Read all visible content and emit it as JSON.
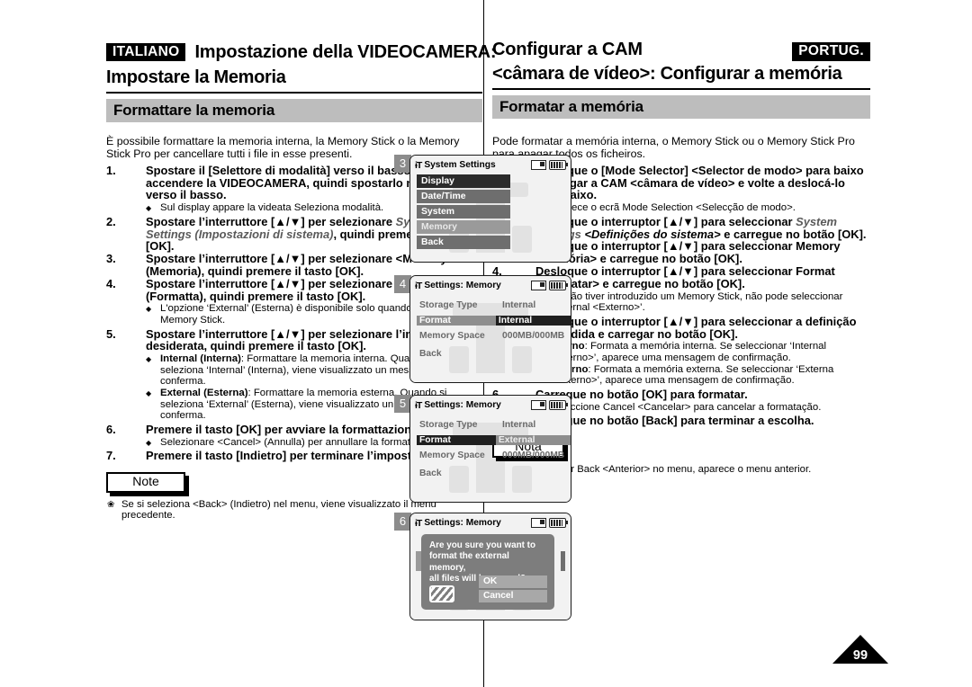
{
  "header": {
    "left": {
      "lang_tag": "ITALIANO",
      "title_line1": "Impostazione della VIDEOCAMERA:",
      "title_line2": "Impostare la Memoria",
      "section": "Formattare la memoria"
    },
    "right": {
      "lang_tag": "PORTUG.",
      "title_line1": "Configurar a CAM",
      "title_line2": "<câmara de vídeo>: Configurar a memória",
      "section": "Formatar a memória"
    }
  },
  "italian": {
    "intro": "È possibile formattare la memoria interna, la Memory Stick o la Memory Stick Pro per cancellare tutti i file in esse presenti.",
    "steps": [
      {
        "num": "1.",
        "text_parts": [
          {
            "t": "Spostare il [Selettore di modalità]  verso il basso per accendere la VIDEOCAMERA, quindi  spostarlo nuovamente verso il basso.",
            "style": "bold"
          }
        ],
        "bullets": [
          "Sul display appare la videata Seleziona modalità."
        ]
      },
      {
        "num": "2.",
        "text_parts": [
          {
            "t": "Spostare l’interruttore [▲/▼] per selezionare ",
            "style": "bold"
          },
          {
            "t": "System Settings (Impostazioni di sistema)",
            "style": "italic-gray"
          },
          {
            "t": ", quindi premere il tasto [OK].",
            "style": "bold"
          }
        ],
        "bullets": []
      },
      {
        "num": "3.",
        "text_parts": [
          {
            "t": "Spostare l’interruttore [▲/▼] per selezionare <Memory> (Memoria), quindi premere il tasto [OK].",
            "style": "bold"
          }
        ],
        "bullets": []
      },
      {
        "num": "4.",
        "text_parts": [
          {
            "t": "Spostare l’interruttore [▲/▼] per selezionare <Format> (Formatta), quindi premere il tasto [OK].",
            "style": "bold"
          }
        ],
        "bullets": [
          "L'opzione ‘External’ (Esterna) è disponibile solo quando si inserisce la Memory Stick."
        ]
      },
      {
        "num": "5.",
        "text_parts": [
          {
            "t": "Spostare l’interruttore [▲/▼] per selezionare l’impostazione desiderata, quindi premere il tasto [OK].",
            "style": "bold"
          }
        ],
        "bullets_rich": [
          {
            "b": "Internal (Interna)",
            "rest": ": Formattare la memoria interna. Quando si seleziona ‘Internal’ (Interna), viene visualizzato un messaggio di conferma."
          },
          {
            "b": "External (Esterna)",
            "rest": ": Formattare la memoria esterna. Quando si seleziona ‘External’ (Esterna), viene visualizzato un messaggio di conferma."
          }
        ]
      },
      {
        "num": "6.",
        "text_parts": [
          {
            "t": "Premere il tasto [OK] per avviare la formattazione.",
            "style": "bold"
          }
        ],
        "bullets": [
          "Selezionare <Cancel> (Annulla) per annullare la formattazione."
        ]
      },
      {
        "num": "7.",
        "text_parts": [
          {
            "t": "Premere il tasto [Indietro] per terminare l’impostazione.",
            "style": "bold"
          }
        ],
        "bullets": []
      }
    ],
    "note_label": "Note",
    "notes": [
      "Se si seleziona <Back> (Indietro) nel menu, viene visualizzato il menu precedente."
    ]
  },
  "portuguese": {
    "intro": "Pode formatar a memória interna, o Memory Stick ou o Memory Stick Pro para apagar todos os ficheiros.",
    "steps": [
      {
        "num": "1.",
        "text_parts": [
          {
            "t": "Desloque o [Mode Selector] <Selector de modo> para baixo para ligar a CAM <câmara de vídeo> e volte a deslocá-lo para baixo.",
            "style": "bold"
          }
        ],
        "bullets": [
          "Aparece o ecrã Mode Selection <Selecção de modo>."
        ]
      },
      {
        "num": "2.",
        "text_parts": [
          {
            "t": "Desloque o interruptor [▲/▼] para seleccionar ",
            "style": "bold"
          },
          {
            "t": "System Settings",
            "style": "italic-gray"
          },
          {
            "t": " <Definições do sistema>",
            "style": "italic-bold"
          },
          {
            "t": " e carregue no botão [OK].",
            "style": "bold"
          }
        ],
        "bullets": []
      },
      {
        "num": "3.",
        "text_parts": [
          {
            "t": "Desloque o interruptor [▲/▼] para seleccionar Memory <Memória> e carregue no botão [OK].",
            "style": "bold"
          }
        ],
        "bullets": []
      },
      {
        "num": "4.",
        "text_parts": [
          {
            "t": "Desloque o interruptor [▲/▼] para seleccionar Format <Formatar> e carregue no botão [OK].",
            "style": "bold"
          }
        ],
        "bullets": [
          "Se não tiver introduzido um Memory Stick, não pode seleccionar ‘External <Externo>’."
        ]
      },
      {
        "num": "5.",
        "text_parts": [
          {
            "t": "Desloque o interruptor [▲/▼] para seleccionar a definição pretendida e carregar no botão [OK].",
            "style": "bold"
          }
        ],
        "bullets_rich": [
          {
            "b": "Interno",
            "rest": ": Formata a memória interna. Se seleccionar ‘Internal <Interno>’, aparece uma mensagem de confirmação."
          },
          {
            "b": "Externo",
            "rest": ": Formata a memória externa. Se seleccionar ‘Externa <Externo>’, aparece uma mensagem de confirmação."
          }
        ]
      },
      {
        "num": "6.",
        "text_parts": [
          {
            "t": "Carregue no botão [OK] para formatar.",
            "style": "bold"
          }
        ],
        "bullets": [
          "Seleccione Cancel <Cancelar> para cancelar a formatação."
        ]
      },
      {
        "num": "7.",
        "text_parts": [
          {
            "t": "Carregue no botão [Back] para terminar a escolha.",
            "style": "bold"
          }
        ],
        "bullets": []
      }
    ],
    "note_label": "Nota",
    "notes": [
      "Se seleccionar Back <Anterior> no menu, aparece o menu anterior."
    ]
  },
  "screens": [
    {
      "badge": "3",
      "title": "System Settings",
      "title_icon": "info-text-icon",
      "status_icons": [
        "memory-card-icon",
        "battery-icon"
      ],
      "menu": [
        {
          "label": "Display",
          "state": "selected"
        },
        {
          "label": "Date/Time",
          "state": "normal"
        },
        {
          "label": "System",
          "state": "normal"
        },
        {
          "label": "Memory",
          "state": "dim"
        },
        {
          "label": "Back",
          "state": "normal"
        }
      ]
    },
    {
      "badge": "4",
      "title": "Settings: Memory",
      "title_icon": "info-text-icon",
      "status_icons": [
        "memory-card-icon",
        "battery-icon"
      ],
      "rows": [
        {
          "label": "Storage Type",
          "value": "Internal",
          "label_state": "plain",
          "value_state": "plain"
        },
        {
          "label": "Format",
          "value": "Internal",
          "label_state": "gray",
          "value_state": "dark"
        },
        {
          "label": "Memory Space",
          "value": "000MB/000MB",
          "label_state": "plain",
          "value_state": "plain"
        },
        {
          "label": "Back",
          "value": "",
          "label_state": "plain",
          "value_state": "plain"
        }
      ]
    },
    {
      "badge": "5",
      "title": "Settings: Memory",
      "title_icon": "info-text-icon",
      "status_icons": [
        "memory-card-icon",
        "battery-icon"
      ],
      "rows": [
        {
          "label": "Storage Type",
          "value": "Internal",
          "label_state": "plain",
          "value_state": "plain"
        },
        {
          "label": "Format",
          "value": "External",
          "label_state": "dark",
          "value_state": "gray"
        },
        {
          "label": "Memory Space",
          "value": "000MB/000MB",
          "label_state": "plain",
          "value_state": "plain"
        },
        {
          "label": "Back",
          "value": "",
          "label_state": "plain",
          "value_state": "plain"
        }
      ]
    },
    {
      "badge": "6",
      "title": "Settings: Memory",
      "title_icon": "info-text-icon",
      "status_icons": [
        "memory-card-icon",
        "battery-icon"
      ],
      "dialog": {
        "message_line1": "Are you sure you want to",
        "message_line2": "format the external memory,",
        "message_line3": "all files will be erased?",
        "ok_label": "OK",
        "cancel_label": "Cancel",
        "icon": "format-warning-icon"
      }
    }
  ],
  "page_number": "99",
  "colors": {
    "section_bar": "#bdbdbd",
    "badge": "#8c8c8c",
    "lcd_bg": "#f2f2f2",
    "menu_selected": "#2b2b2b",
    "menu_normal": "#6e6e6e",
    "menu_dim": "#9a9a9a",
    "dialog_bg": "#7d7d7d"
  }
}
